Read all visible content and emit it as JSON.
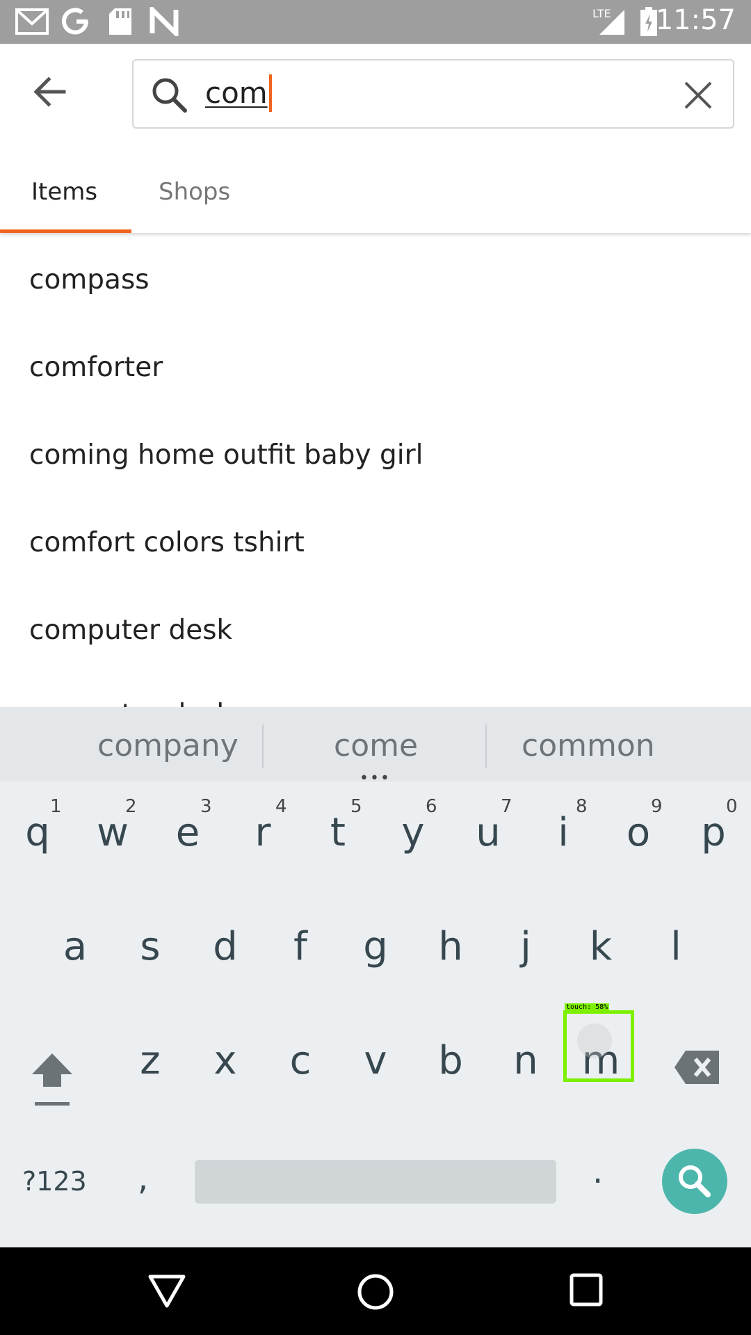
{
  "status_bar": {
    "time": "11:57",
    "network": "LTE",
    "icons": [
      "gmail-icon",
      "google-icon",
      "sd-card-icon",
      "n-icon",
      "signal-icon",
      "battery-icon"
    ]
  },
  "search": {
    "query": "com",
    "accent_color": "#f1641e"
  },
  "tabs": [
    {
      "label": "Items",
      "selected": true
    },
    {
      "label": "Shops",
      "selected": false
    }
  ],
  "suggestions": [
    "compass",
    "comforter",
    "coming home outfit baby girl",
    "comfort colors tshirt",
    "computer desk",
    "computer desk"
  ],
  "keyboard": {
    "word_suggestions": [
      "company",
      "come",
      "common"
    ],
    "row1": [
      "q",
      "w",
      "e",
      "r",
      "t",
      "y",
      "u",
      "i",
      "o",
      "p"
    ],
    "row1_numbers": [
      "1",
      "2",
      "3",
      "4",
      "5",
      "6",
      "7",
      "8",
      "9",
      "0"
    ],
    "row2": [
      "a",
      "s",
      "d",
      "f",
      "g",
      "h",
      "j",
      "k",
      "l"
    ],
    "row3": [
      "z",
      "x",
      "c",
      "v",
      "b",
      "n",
      "m"
    ],
    "symbols_label": "?123",
    "comma": ",",
    "period": ".",
    "search_key_color": "#4db6ac"
  },
  "touch_indicator": {
    "label": "touch: 58%"
  }
}
